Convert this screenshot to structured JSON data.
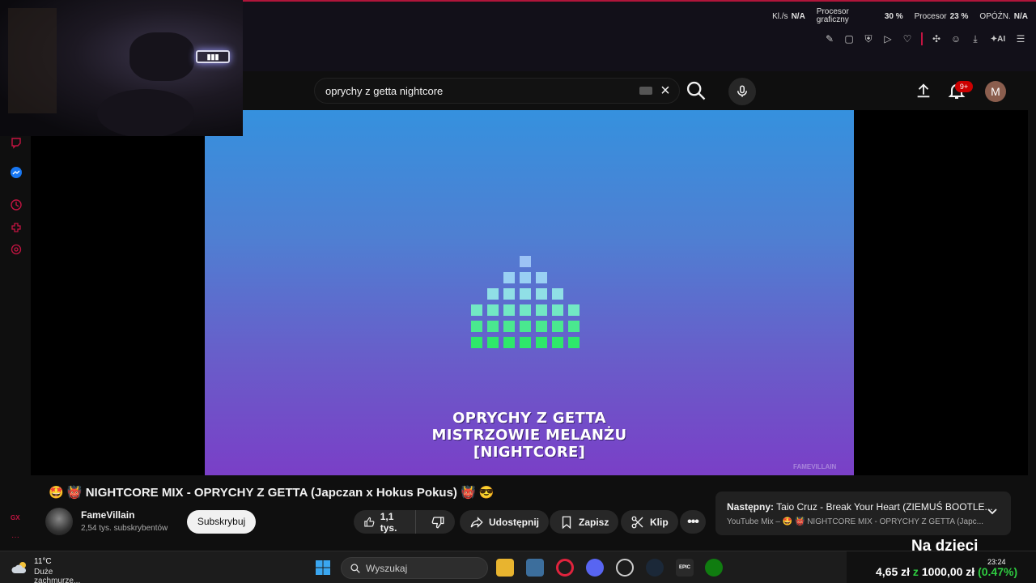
{
  "hw_stats": {
    "kls_label": "Kl./s",
    "kls_value": "N/A",
    "gpu_label_1": "Procesor",
    "gpu_label_2": "graficzny",
    "gpu_value": "30 %",
    "cpu_label": "Procesor",
    "cpu_value": "23 %",
    "lag_label": "OPÓŹN.",
    "lag_value": "N/A"
  },
  "search": {
    "query": "oprychy z getta nightcore"
  },
  "notifications": {
    "badge": "9+"
  },
  "account": {
    "initial": "M"
  },
  "video": {
    "overlay_line1": "OPRYCHY Z GETTA",
    "overlay_line2": "MISTRZOWIE MELANŻU",
    "overlay_line3": "[NIGHTCORE]",
    "watermark": "FAMEVILLAIN",
    "title": "🤩 👹 NIGHTCORE MIX - OPRYCHY Z GETTA (Japczan x Hokus Pokus) 👹 😎"
  },
  "channel": {
    "name": "FameVillain",
    "subscribers": "2,54 tys. subskrybentów",
    "subscribe_label": "Subskrybuj"
  },
  "actions": {
    "likes": "1,1 tys.",
    "share": "Udostępnij",
    "save": "Zapisz",
    "clip": "Klip"
  },
  "next_up": {
    "label": "Następny:",
    "title": "Taio Cruz - Break Your Heart (ZIEMUŚ BOOTLE...",
    "subtitle": "YouTube Mix – 🤩 👹 NIGHTCORE MIX - OPRYCHY Z GETTA (Japc..."
  },
  "overlay_text": "Na dzieci",
  "taskbar": {
    "temp": "11°C",
    "weather": "Duże zachmurze...",
    "search_placeholder": "Wyszukaj",
    "stock_value": "4,65 zł",
    "stock_z": "z",
    "stock_amount": "1000,00 zł",
    "stock_pct": "(0.47%)",
    "time": "23:24"
  },
  "colors": {
    "gx_accent": "#c41442",
    "youtube_red": "#cc0000",
    "eq_top": "#8fb8f4",
    "eq_bottom": "#2ee86a"
  }
}
